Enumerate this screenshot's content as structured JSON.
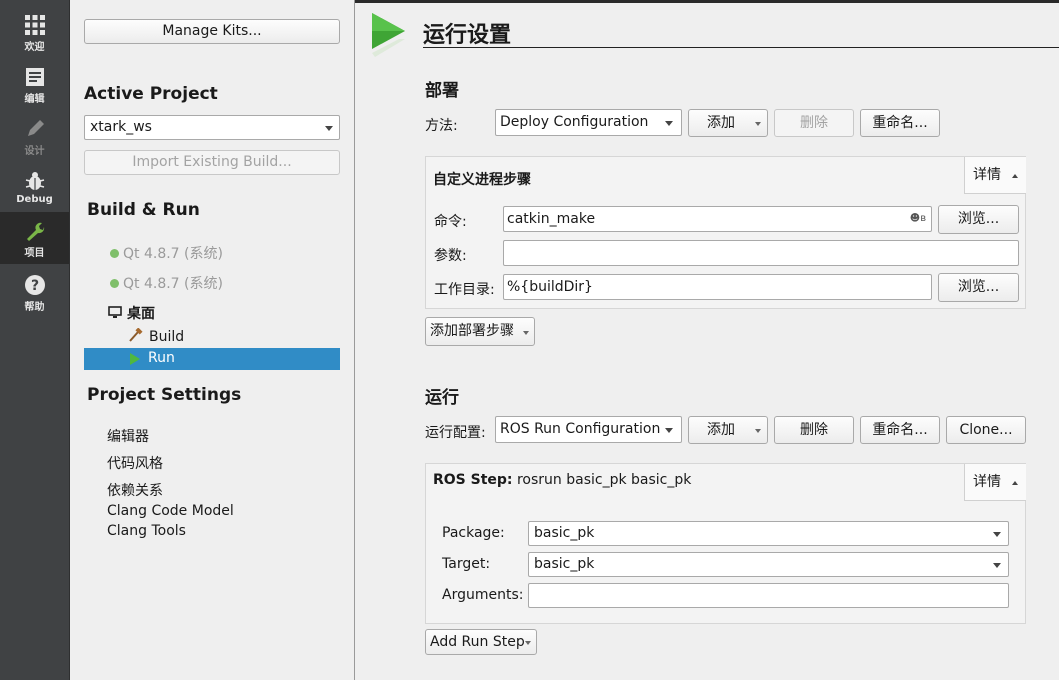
{
  "modebar": {
    "items": [
      {
        "label": "欢迎",
        "icon": "grid-icon"
      },
      {
        "label": "编辑",
        "icon": "document-icon"
      },
      {
        "label": "设计",
        "icon": "pencil-icon"
      },
      {
        "label": "Debug",
        "icon": "bug-icon"
      },
      {
        "label": "项目",
        "icon": "wrench-icon"
      },
      {
        "label": "帮助",
        "icon": "help-icon"
      }
    ]
  },
  "left": {
    "manage_kits": "Manage Kits...",
    "active_project_heading": "Active Project",
    "project_combo": "xtark_ws",
    "import_build": "Import Existing Build...",
    "build_run_heading": "Build & Run",
    "kits": [
      "Qt 4.8.7 (系统)",
      "Qt 4.8.7 (系统)"
    ],
    "desktop": "桌面",
    "build": "Build",
    "run": "Run",
    "project_settings_heading": "Project Settings",
    "settings": [
      "编辑器",
      "代码风格",
      "依赖关系",
      "Clang Code Model",
      "Clang Tools"
    ]
  },
  "main": {
    "title": "运行设置",
    "deploy": {
      "heading": "部署",
      "method_label": "方法:",
      "method_value": "Deploy Configuration",
      "add": "添加",
      "remove": "删除",
      "rename": "重命名...",
      "step_title": "自定义进程步骤",
      "details": "详情",
      "command_label": "命令:",
      "command_value": "catkin_make",
      "browse": "浏览...",
      "args_label": "参数:",
      "args_value": "",
      "workdir_label": "工作目录:",
      "workdir_value": "%{buildDir}",
      "add_step": "添加部署步骤"
    },
    "run": {
      "heading": "运行",
      "config_label": "运行配置:",
      "config_value": "ROS Run Configuration",
      "add": "添加",
      "remove": "删除",
      "rename": "重命名...",
      "clone": "Clone...",
      "step_bold": "ROS Step:",
      "step_text": " rosrun basic_pk basic_pk",
      "details": "详情",
      "package_label": "Package:",
      "package_value": "basic_pk",
      "target_label": "Target:",
      "target_value": "basic_pk",
      "arguments_label": "Arguments:",
      "arguments_value": "",
      "add_run_step": "Add Run Step"
    }
  },
  "colors": {
    "modebar_bg": "#404244",
    "selection": "#308cc6",
    "play_green": "#3fa535",
    "wrench_green": "#7ab648"
  }
}
